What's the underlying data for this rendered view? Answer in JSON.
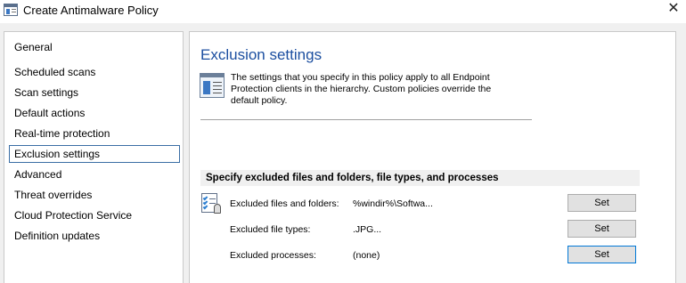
{
  "window": {
    "title": "Create Antimalware Policy",
    "close_glyph": "✕"
  },
  "nav": {
    "items": [
      {
        "label": "General",
        "selected": false
      },
      {
        "label": "Scheduled scans",
        "selected": false
      },
      {
        "label": "Scan settings",
        "selected": false
      },
      {
        "label": "Default actions",
        "selected": false
      },
      {
        "label": "Real-time protection",
        "selected": false
      },
      {
        "label": "Exclusion settings",
        "selected": true
      },
      {
        "label": "Advanced",
        "selected": false
      },
      {
        "label": "Threat overrides",
        "selected": false
      },
      {
        "label": "Cloud Protection Service",
        "selected": false
      },
      {
        "label": "Definition updates",
        "selected": false
      }
    ]
  },
  "main": {
    "title": "Exclusion settings",
    "info": "The settings that you specify in this policy apply to all Endpoint Protection clients in the hierarchy. Custom policies override the default policy.",
    "section_header": "Specify excluded files and folders, file types, and processes",
    "rows": [
      {
        "label": "Excluded files and folders:",
        "value": "%windir%\\Softwa...",
        "button": "Set"
      },
      {
        "label": "Excluded file types:",
        "value": ".JPG...",
        "button": "Set"
      },
      {
        "label": "Excluded processes:",
        "value": "(none)",
        "button": "Set"
      }
    ]
  },
  "colors": {
    "title_blue": "#1c4fa0",
    "selection_border": "#3a6ea5",
    "focus_border": "#0078d7"
  }
}
